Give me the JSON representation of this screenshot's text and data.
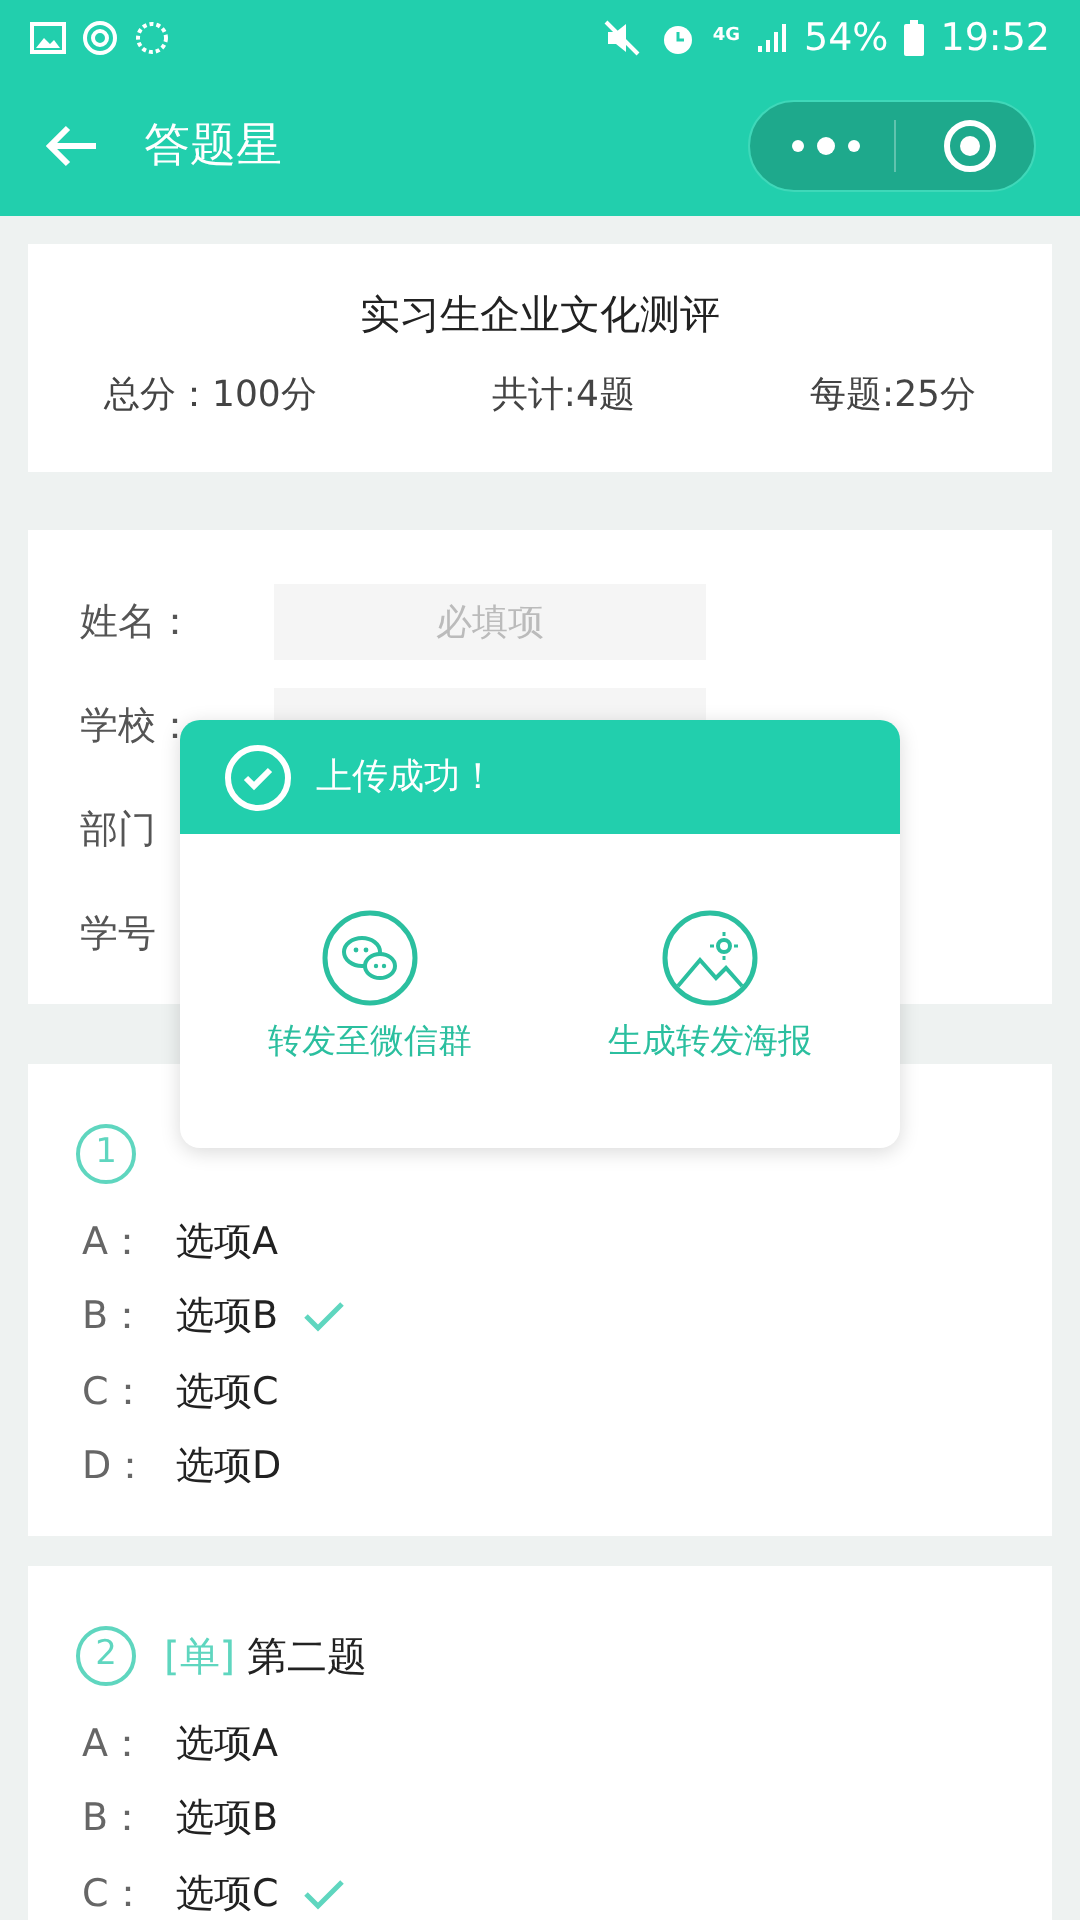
{
  "status_bar": {
    "battery": "54%",
    "time": "19:52",
    "network": "4G"
  },
  "nav": {
    "title": "答题星"
  },
  "quiz": {
    "title": "实习生企业文化测评",
    "stats": [
      "总分：100分",
      "共计:4题",
      "每题:25分"
    ]
  },
  "form": [
    {
      "label": "姓名：",
      "placeholder": "必填项"
    },
    {
      "label": "学校：",
      "kind": "input"
    },
    {
      "label": "部门"
    },
    {
      "label": "学号"
    }
  ],
  "questions": [
    {
      "number": "1",
      "options": [
        {
          "letter": "A：",
          "text": "选项A",
          "selected": false
        },
        {
          "letter": "B：",
          "text": "选项B",
          "selected": true
        },
        {
          "letter": "C：",
          "text": "选项C",
          "selected": false
        },
        {
          "letter": "D：",
          "text": "选项D",
          "selected": false
        }
      ]
    },
    {
      "number": "2",
      "type": "[单]",
      "title": "第二题",
      "options": [
        {
          "letter": "A：",
          "text": "选项A",
          "selected": false
        },
        {
          "letter": "B：",
          "text": "选项B",
          "selected": false
        },
        {
          "letter": "C：",
          "text": "选项C",
          "selected": true
        }
      ]
    }
  ],
  "popup": {
    "title": "上传成功！",
    "actions": [
      {
        "kind": "wechat",
        "label": "转发至微信群"
      },
      {
        "kind": "poster",
        "label": "生成转发海报"
      }
    ]
  }
}
